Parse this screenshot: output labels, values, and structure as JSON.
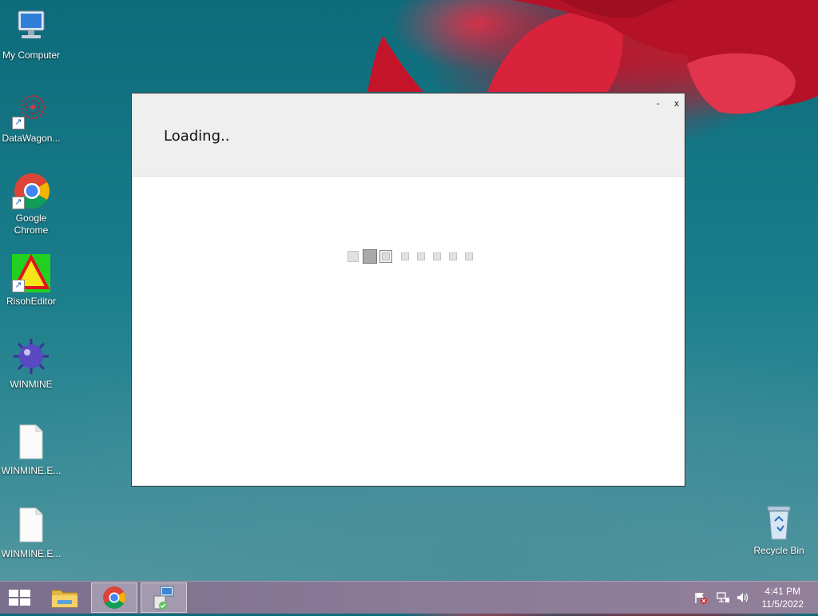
{
  "desktop": {
    "icons": [
      {
        "label": "My Computer"
      },
      {
        "label": "DataWagon..."
      },
      {
        "label": "Google Chrome"
      },
      {
        "label": "RisohEditor"
      },
      {
        "label": "WINMINE"
      },
      {
        "label": "WINMINE.E..."
      },
      {
        "label": "WINMINE.E..."
      },
      {
        "label": "Recycle Bin"
      }
    ]
  },
  "window": {
    "status_text": "Loading..",
    "minimize_label": "-",
    "close_label": "x"
  },
  "taskbar": {
    "clock_time": "4:41 PM",
    "clock_date": "11/5/2022"
  },
  "colors": {
    "taskbar": "#8a7b98",
    "desktop_bg": "#1a7d8b",
    "accent_red": "#c8182a"
  }
}
